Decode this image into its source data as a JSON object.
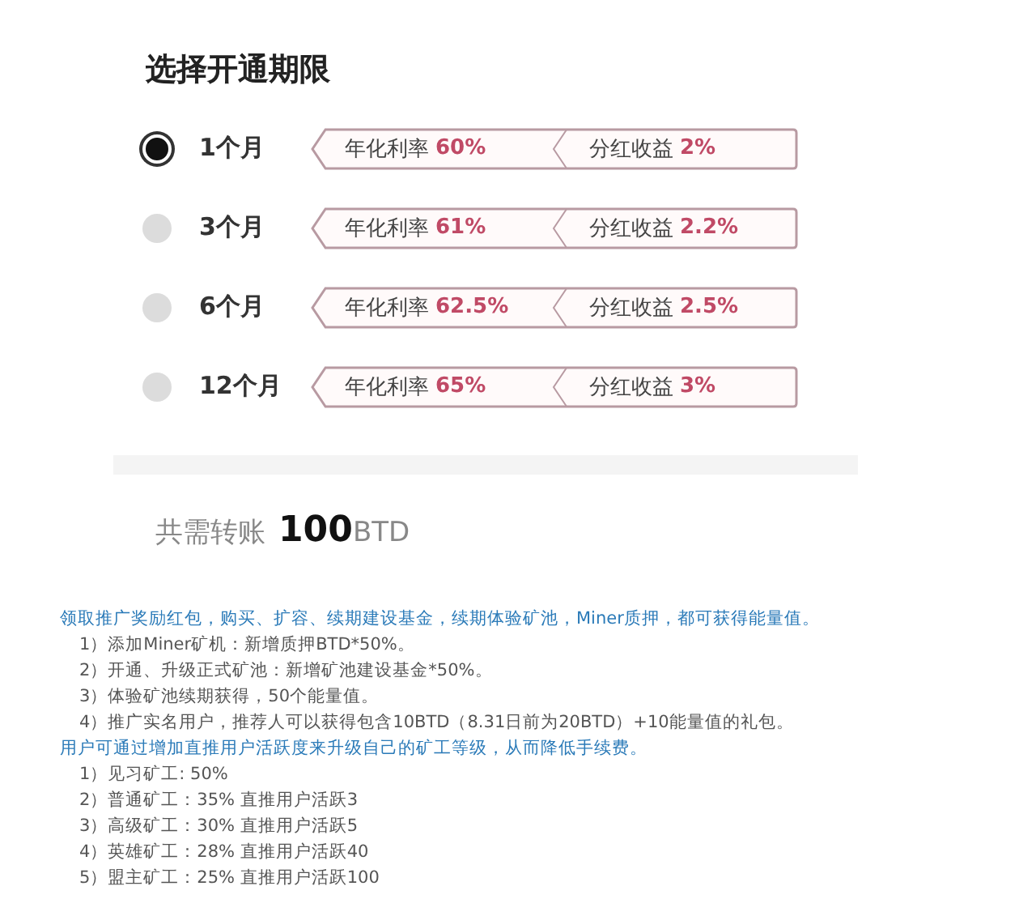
{
  "title": "选择开通期限",
  "plans": [
    {
      "label": "1个月",
      "selected": true,
      "rate_label": "年化利率",
      "rate": "60%",
      "bonus_label": "分红收益",
      "bonus": "2%"
    },
    {
      "label": "3个月",
      "selected": false,
      "rate_label": "年化利率",
      "rate": "61%",
      "bonus_label": "分红收益",
      "bonus": "2.2%"
    },
    {
      "label": "6个月",
      "selected": false,
      "rate_label": "年化利率",
      "rate": "62.5%",
      "bonus_label": "分红收益",
      "bonus": "2.5%"
    },
    {
      "label": "12个月",
      "selected": false,
      "rate_label": "年化利率",
      "rate": "65%",
      "bonus_label": "分红收益",
      "bonus": "3%"
    }
  ],
  "total": {
    "label": "共需转账",
    "amount": "100",
    "unit": "BTD"
  },
  "notes": [
    {
      "kind": "heading",
      "text": "领取推广奖励红包，购买、扩容、续期建设基金，续期体验矿池，Miner质押，都可获得能量值。"
    },
    {
      "kind": "item",
      "text": "1）添加Miner矿机：新增质押BTD*50%。"
    },
    {
      "kind": "item",
      "text": "2）开通、升级正式矿池：新增矿池建设基金*50%。"
    },
    {
      "kind": "item",
      "text": "3）体验矿池续期获得，50个能量值。"
    },
    {
      "kind": "item",
      "text": "4）推广实名用户，推荐人可以获得包含10BTD（8.31日前为20BTD）+10能量值的礼包。"
    },
    {
      "kind": "heading",
      "text": "用户可通过增加直推用户活跃度来升级自己的矿工等级，从而降低手续费。"
    },
    {
      "kind": "item",
      "text": "1）见习矿工: 50%"
    },
    {
      "kind": "item",
      "text": "2）普通矿工：35% 直推用户活跃3"
    },
    {
      "kind": "item",
      "text": "3）高级矿工：30% 直推用户活跃5"
    },
    {
      "kind": "item",
      "text": "4）英雄矿工：28% 直推用户活跃40"
    },
    {
      "kind": "item",
      "text": "5）盟主矿工：25% 直推用户活跃100"
    }
  ]
}
